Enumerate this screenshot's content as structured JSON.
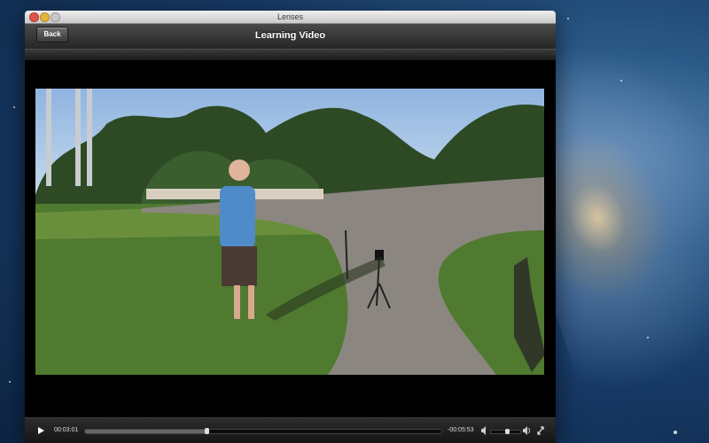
{
  "window": {
    "title": "Lenses"
  },
  "navbar": {
    "back_label": "Back",
    "title": "Learning Video"
  },
  "player": {
    "elapsed": "00:03:01",
    "remaining": "-00:05:53",
    "progress": 0.34,
    "volume": 0.55
  },
  "icons": {
    "play": "play-icon",
    "volume_low": "volume-low-icon",
    "volume_high": "volume-high-icon",
    "fullscreen": "fullscreen-icon"
  }
}
